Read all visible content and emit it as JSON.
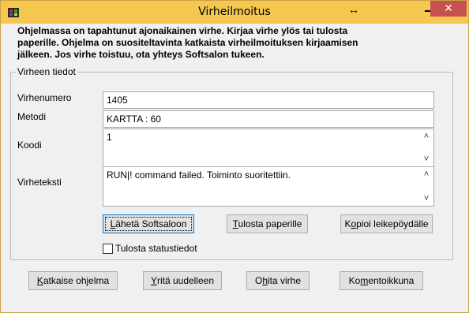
{
  "window": {
    "title": "Virheilmoitus",
    "resize_glyph": "↔",
    "close_glyph": "✕",
    "accent_color": "#f5c74f",
    "close_color": "#c75050"
  },
  "intro_text": "Ohjelmassa on tapahtunut ajonaikainen virhe. Kirjaa virhe ylös tai tulosta paperille. Ohjelma on suositeltavinta  katkaista virheilmoituksen kirjaamisen jälkeen. Jos virhe toistuu, ota yhteys Softsalon tukeen.",
  "group": {
    "title": "Virheen tiedot",
    "fields": {
      "virhenumero": {
        "label": "Virhenumero",
        "value": "1405"
      },
      "metodi": {
        "label": "Metodi",
        "value": "KARTTA : 60"
      },
      "koodi": {
        "label": "Koodi",
        "value": "1"
      },
      "virheteksti": {
        "label": "Virheteksti",
        "value": "RUN|! command failed. Toiminto suoritettiin."
      }
    },
    "buttons": {
      "laheta": {
        "mnemonic": "L",
        "rest": "ähetä Softsaloon"
      },
      "tulosta": {
        "mnemonic": "T",
        "rest": "ulosta paperille"
      },
      "kopioi": {
        "pre": "K",
        "mnemonic": "o",
        "rest": "pioi leikepöydälle"
      }
    },
    "checkbox": {
      "label": "Tulosta statustiedot",
      "checked": false
    }
  },
  "footer_buttons": {
    "katkaise": {
      "mnemonic": "K",
      "rest": "atkaise ohjelma"
    },
    "yrita": {
      "mnemonic": "Y",
      "rest": "ritä uudelleen"
    },
    "ohita": {
      "pre": "O",
      "mnemonic": "h",
      "rest": "ita virhe"
    },
    "komentoikkuna": {
      "pre": "Ko",
      "mnemonic": "m",
      "rest": "entoikkuna"
    }
  }
}
